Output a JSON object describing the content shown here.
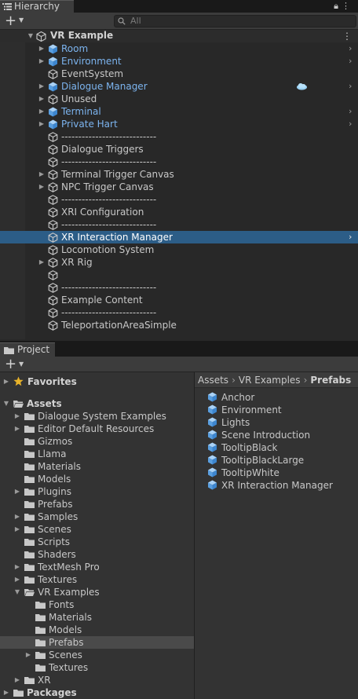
{
  "hierarchy": {
    "tab_label": "Hierarchy",
    "tab_icon": "hierarchy-list-icon",
    "lock_icon": "lock-icon",
    "menu_icon": "kebab-menu-icon",
    "search_placeholder": "All",
    "scene_name": "VR Example",
    "items": [
      {
        "label": "Room",
        "type": "prefab",
        "foldout": true,
        "chevron": true,
        "depth": 1
      },
      {
        "label": "Environment",
        "type": "prefab",
        "foldout": true,
        "chevron": true,
        "depth": 1
      },
      {
        "label": "EventSystem",
        "type": "normal",
        "foldout": false,
        "chevron": false,
        "depth": 1
      },
      {
        "label": "Dialogue Manager",
        "type": "prefab",
        "foldout": true,
        "chevron": true,
        "depth": 1,
        "badge": "cloud-icon"
      },
      {
        "label": "Unused",
        "type": "normal",
        "foldout": true,
        "chevron": false,
        "depth": 1
      },
      {
        "label": "Terminal",
        "type": "prefab",
        "foldout": true,
        "chevron": true,
        "depth": 1
      },
      {
        "label": "Private Hart",
        "type": "prefab",
        "foldout": true,
        "chevron": true,
        "depth": 1
      },
      {
        "label": "----------------------------",
        "type": "normal",
        "foldout": false,
        "chevron": false,
        "depth": 1
      },
      {
        "label": "Dialogue Triggers",
        "type": "normal",
        "foldout": false,
        "chevron": false,
        "depth": 1
      },
      {
        "label": "----------------------------",
        "type": "normal",
        "foldout": false,
        "chevron": false,
        "depth": 1
      },
      {
        "label": "Terminal Trigger Canvas",
        "type": "normal",
        "foldout": true,
        "chevron": false,
        "depth": 1
      },
      {
        "label": "NPC Trigger Canvas",
        "type": "normal",
        "foldout": true,
        "chevron": false,
        "depth": 1
      },
      {
        "label": "----------------------------",
        "type": "normal",
        "foldout": false,
        "chevron": false,
        "depth": 1
      },
      {
        "label": "XRI Configuration",
        "type": "normal",
        "foldout": false,
        "chevron": false,
        "depth": 1
      },
      {
        "label": "----------------------------",
        "type": "normal",
        "foldout": false,
        "chevron": false,
        "depth": 1
      },
      {
        "label": "XR Interaction Manager",
        "type": "selected",
        "foldout": false,
        "chevron": true,
        "depth": 1
      },
      {
        "label": "Locomotion System",
        "type": "normal",
        "foldout": false,
        "chevron": false,
        "depth": 1
      },
      {
        "label": "XR Rig",
        "type": "normal",
        "foldout": true,
        "chevron": false,
        "depth": 1
      },
      {
        "label": "",
        "type": "normal",
        "foldout": false,
        "chevron": false,
        "depth": 1
      },
      {
        "label": "----------------------------",
        "type": "normal",
        "foldout": false,
        "chevron": false,
        "depth": 1
      },
      {
        "label": "Example Content",
        "type": "normal",
        "foldout": false,
        "chevron": false,
        "depth": 1
      },
      {
        "label": "----------------------------",
        "type": "normal",
        "foldout": false,
        "chevron": false,
        "depth": 1
      },
      {
        "label": "TeleportationAreaSimple",
        "type": "normal",
        "foldout": false,
        "chevron": false,
        "depth": 1
      }
    ]
  },
  "project": {
    "tab_label": "Project",
    "tab_icon": "folder-icon",
    "favorites_label": "Favorites",
    "tree": [
      {
        "label": "Assets",
        "depth": 0,
        "foldout": "open",
        "bold": true,
        "gap_before": true
      },
      {
        "label": "Dialogue System Examples",
        "depth": 1,
        "foldout": "closed"
      },
      {
        "label": "Editor Default Resources",
        "depth": 1,
        "foldout": "closed"
      },
      {
        "label": "Gizmos",
        "depth": 1,
        "foldout": "none"
      },
      {
        "label": "Llama",
        "depth": 1,
        "foldout": "none"
      },
      {
        "label": "Materials",
        "depth": 1,
        "foldout": "none"
      },
      {
        "label": "Models",
        "depth": 1,
        "foldout": "none"
      },
      {
        "label": "Plugins",
        "depth": 1,
        "foldout": "closed"
      },
      {
        "label": "Prefabs",
        "depth": 1,
        "foldout": "none"
      },
      {
        "label": "Samples",
        "depth": 1,
        "foldout": "closed"
      },
      {
        "label": "Scenes",
        "depth": 1,
        "foldout": "closed"
      },
      {
        "label": "Scripts",
        "depth": 1,
        "foldout": "none"
      },
      {
        "label": "Shaders",
        "depth": 1,
        "foldout": "none"
      },
      {
        "label": "TextMesh Pro",
        "depth": 1,
        "foldout": "closed"
      },
      {
        "label": "Textures",
        "depth": 1,
        "foldout": "closed"
      },
      {
        "label": "VR Examples",
        "depth": 1,
        "foldout": "open"
      },
      {
        "label": "Fonts",
        "depth": 2,
        "foldout": "none"
      },
      {
        "label": "Materials",
        "depth": 2,
        "foldout": "none"
      },
      {
        "label": "Models",
        "depth": 2,
        "foldout": "none"
      },
      {
        "label": "Prefabs",
        "depth": 2,
        "foldout": "none",
        "selected": true
      },
      {
        "label": "Scenes",
        "depth": 2,
        "foldout": "closed"
      },
      {
        "label": "Textures",
        "depth": 2,
        "foldout": "none"
      },
      {
        "label": "XR",
        "depth": 1,
        "foldout": "closed"
      },
      {
        "label": "Packages",
        "depth": 0,
        "foldout": "closed",
        "bold": true
      }
    ],
    "breadcrumb": [
      "Assets",
      "VR Examples",
      "Prefabs"
    ],
    "assets": [
      "Anchor",
      "Environment",
      "Lights",
      "Scene Introduction",
      "TooltipBlack",
      "TooltipBlackLarge",
      "TooltipWhite",
      "XR Interaction Manager"
    ]
  },
  "colors": {
    "prefab_blue": "#7cb4ef",
    "selection_blue": "#2c5d87",
    "favorites_star": "#e8b32a"
  }
}
